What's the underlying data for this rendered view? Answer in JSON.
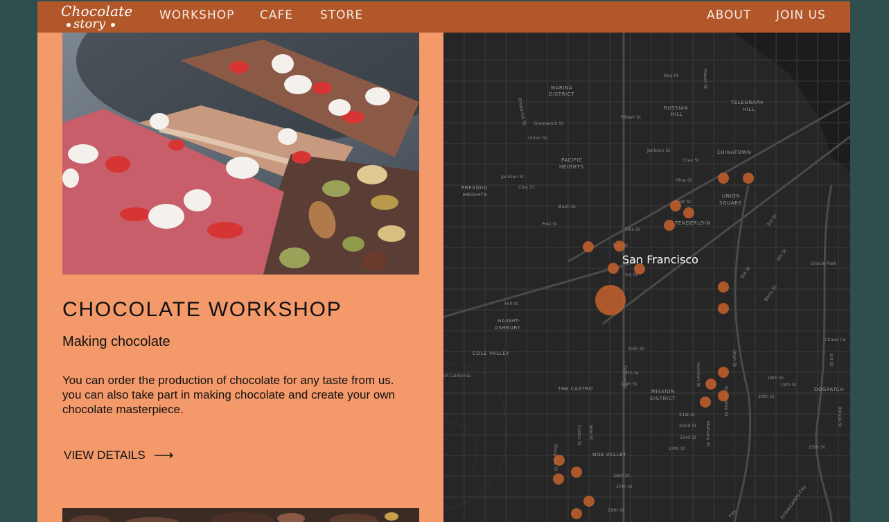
{
  "brand": {
    "line1": "Chocolate",
    "line2": "story"
  },
  "nav": {
    "left": [
      "WORKSHOP",
      "CAFE",
      "STORE"
    ],
    "right": [
      "ABOUT",
      "JOIN US"
    ]
  },
  "workshop": {
    "title": "CHOCOLATE WORKSHOP",
    "subtitle": "Making chocolate",
    "description": "You can order the production of chocolate for any taste from us. you can also take part in making chocolate and create your own chocolate masterpiece.",
    "cta_label": "VIEW DETAILS",
    "cta_icon": "arrow-right-icon"
  },
  "map": {
    "city_label": "San Francisco",
    "districts": [
      "MARINA DISTRICT",
      "RUSSIAN HILL",
      "TELEGRAPH HILL",
      "CHINATOWN",
      "PACIFIC HEIGHTS",
      "PRESIDIO HEIGHTS",
      "UNION SQUARE",
      "TENDERLOIN",
      "HAIGHT-ASHBURY",
      "COLE VALLEY",
      "THE CASTRO",
      "MISSION DISTRICT",
      "NOE VALLEY",
      "DOGPATCH"
    ],
    "streets": [
      "Bay St",
      "Powell St",
      "Filbert St",
      "Greenwich St",
      "Union St",
      "Broderick St",
      "Jackson St",
      "Clay St",
      "Pine St",
      "Post St",
      "Bush St",
      "Ellis St",
      "Turk St",
      "Ivy St",
      "Fell St",
      "15th St",
      "17th St",
      "18th St",
      "21st St",
      "22nd St",
      "23rd St",
      "24th St",
      "26th St",
      "27th St",
      "29th St",
      "Dolores St",
      "Castro St",
      "Noe St",
      "Douglass St",
      "Harrison St",
      "Utah St",
      "Hampshire St",
      "Alabama St",
      "Berry St",
      "4th St",
      "6th St",
      "3rd St",
      "Oracle Park",
      "Chase Ce",
      "19th St",
      "20th St",
      "25th St",
      "Illinois St",
      "Embarcadero Fwy",
      "Fwy",
      "of California"
    ],
    "marker_color": "#c4622d"
  },
  "colors": {
    "header": "#b2572a",
    "panel": "#f4996a",
    "frame": "#2f4e4e",
    "map": "#262626"
  }
}
